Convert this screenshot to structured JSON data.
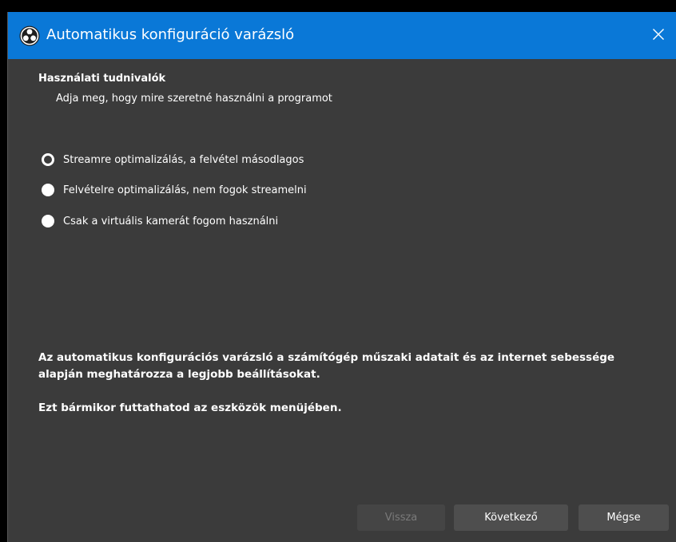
{
  "window": {
    "title": "Automatikus konfiguráció varázsló",
    "icon": "obs-logo-icon",
    "close_icon": "close-icon"
  },
  "colors": {
    "titlebar": "#0a78d7",
    "background": "#3b3b3b",
    "button": "#4e4e4e",
    "button_disabled_text": "#7a7a7a"
  },
  "section": {
    "title": "Használati tudnivalók",
    "subtitle": "Adja meg, hogy mire szeretné használni a programot"
  },
  "options": [
    {
      "label": "Streamre optimalizálás, a felvétel másodlagos",
      "selected": false
    },
    {
      "label": "Felvételre optimalizálás, nem fogok streamelni",
      "selected": false
    },
    {
      "label": "Csak a virtuális kamerát fogom használni",
      "selected": false
    }
  ],
  "info": {
    "paragraph1": "Az automatikus konfigurációs varázsló a számítógép műszaki adatait és az internet sebessége alapján meghatározza a legjobb beállításokat.",
    "paragraph2": "Ezt bármikor futtathatod az eszközök menüjében."
  },
  "buttons": {
    "back": "Vissza",
    "next": "Következő",
    "cancel": "Mégse"
  }
}
